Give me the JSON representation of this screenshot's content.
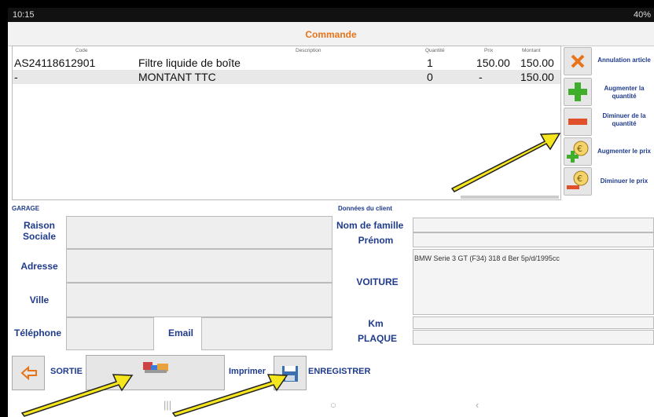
{
  "status": {
    "time": "10:15",
    "battery": "40%"
  },
  "title": "Commande",
  "table": {
    "headers": {
      "code": "Code",
      "description": "Description",
      "qty": "Quantité",
      "price": "Prix",
      "amount": "Montant"
    },
    "rows": [
      {
        "code": "AS24118612901",
        "description": "Filtre liquide de boîte",
        "qty": "1",
        "price": "150.00",
        "amount": "150.00"
      },
      {
        "code": "-",
        "description": "MONTANT TTC",
        "qty": "0",
        "price": "-",
        "amount": "150.00"
      }
    ]
  },
  "side_actions": [
    {
      "label": "Annulation article",
      "icon": "cancel-x-icon"
    },
    {
      "label": "Augmenter la quantité",
      "icon": "plus-icon"
    },
    {
      "label": "Diminuer de la quantité",
      "icon": "minus-icon"
    },
    {
      "label": "Augmenter le prix",
      "icon": "euro-plus-icon"
    },
    {
      "label": "Diminuer le prix",
      "icon": "euro-minus-icon"
    }
  ],
  "garage": {
    "section": "GARAGE",
    "raison_label": "Raison Sociale",
    "adresse_label": "Adresse",
    "ville_label": "Ville",
    "telephone_label": "Téléphone",
    "email_label": "Email"
  },
  "client": {
    "section": "Données du client",
    "nom_label": "Nom de famille",
    "prenom_label": "Prénom",
    "voiture_label": "VOITURE",
    "voiture_value": "BMW Serie 3 GT (F34) 318 d Ber 5p/d/1995cc",
    "km_label": "Km",
    "plaque_label": "PLAQUE"
  },
  "bottom": {
    "sortie": "SORTIE",
    "imprimer": "Imprimer",
    "enregistrer": "ENREGISTRER"
  },
  "colors": {
    "accent": "#e8741a",
    "label": "#1f3b8c",
    "arrow": "#f5e61e"
  }
}
